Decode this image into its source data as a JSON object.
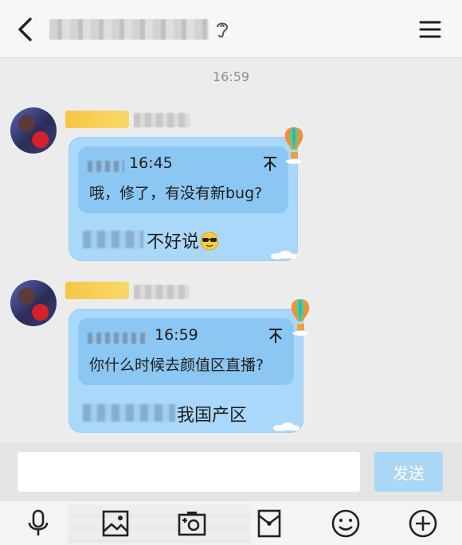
{
  "header": {
    "icons": {
      "back": "back-arrow-icon",
      "ear": "ear-icon",
      "menu": "hamburger-menu-icon"
    }
  },
  "timestamp": "16:59",
  "messages": [
    {
      "quote_time": "16:45",
      "quote_arrow": "不",
      "quote_text": "哦，修了，有没有新bug?",
      "reply_text": "不好说",
      "reply_emoji": "sunglasses-face-icon"
    },
    {
      "quote_time": "16:59",
      "quote_arrow": "不",
      "quote_text": "你什么时候去颜值区直播?",
      "reply_text": "我国产区"
    }
  ],
  "composer": {
    "input_value": "",
    "send_label": "发送"
  },
  "toolbar": {
    "icons": [
      "microphone-icon",
      "image-icon",
      "camera-icon",
      "red-packet-icon",
      "emoji-icon",
      "plus-icon"
    ]
  },
  "colors": {
    "bubble": "#aad8fb",
    "quote": "#8cc6f2",
    "send_button": "#a9d7f5",
    "badge": "#f6c744"
  }
}
